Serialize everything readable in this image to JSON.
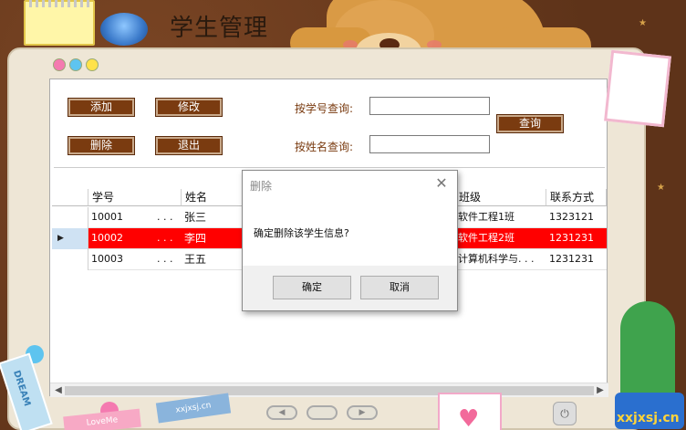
{
  "app": {
    "title": "学生管理"
  },
  "toolbar": {
    "add_label": "添加",
    "edit_label": "修改",
    "delete_label": "删除",
    "exit_label": "退出",
    "search_label": "查询",
    "by_id_label": "按学号查询:",
    "by_name_label": "按姓名查询:",
    "by_id_value": "",
    "by_name_value": ""
  },
  "grid": {
    "columns": [
      "学号",
      "姓名",
      "班级",
      "联系方式"
    ],
    "rows": [
      {
        "id": "10001",
        "dots": ". . .",
        "name": "张三",
        "class": "软件工程1班",
        "phone": "1323121",
        "selected": false
      },
      {
        "id": "10002",
        "dots": ". . .",
        "name": "李四",
        "class": "软件工程2班",
        "phone": "1231231",
        "selected": true
      },
      {
        "id": "10003",
        "dots": ". . .",
        "name": "王五",
        "class": "计算机科学与. . .",
        "phone": "1231231",
        "selected": false
      }
    ]
  },
  "dialog": {
    "title": "删除",
    "message": "确定删除该学生信息?",
    "ok_label": "确定",
    "cancel_label": "取消"
  },
  "decor": {
    "dream": "DREAM",
    "site_tag": "xxjxsj.cn",
    "love_tag": "LoveMe",
    "watermark": "xxjxsj.cn"
  },
  "colors": {
    "button_bg": "#7a3b10",
    "selected_row": "#ff0000",
    "background": "#6b3a1e"
  }
}
